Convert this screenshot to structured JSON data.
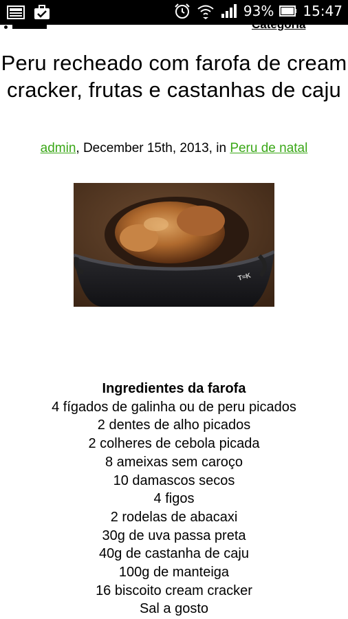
{
  "status_bar": {
    "battery_percent": "93%",
    "time": "15:47",
    "icons": [
      "gallery-icon",
      "briefcase-check-icon",
      "alarm-icon",
      "wifi-icon",
      "signal-icon",
      "battery-icon"
    ]
  },
  "top": {
    "category_link": "Categoria"
  },
  "post": {
    "title": "Peru recheado com farofa de cream cracker, frutas e castanhas de caju",
    "author": "admin",
    "date_text": ", December 15th, 2013, in ",
    "category": "Peru de natal"
  },
  "ingredients": {
    "heading": "Ingredientes da farofa",
    "items": [
      "4 fígados de galinha ou de peru picados",
      "2 dentes de alho picados",
      "2 colheres de cebola picada",
      "8 ameixas sem caroço",
      "10 damascos secos",
      "4 figos",
      "2 rodelas de abacaxi",
      "30g de uva passa preta",
      "40g de castanha de caju",
      "100g de manteiga",
      "16 biscoito cream cracker",
      "Sal a gosto"
    ]
  },
  "colors": {
    "link_green": "#3aa717",
    "status_bar_bg": "#000000"
  }
}
